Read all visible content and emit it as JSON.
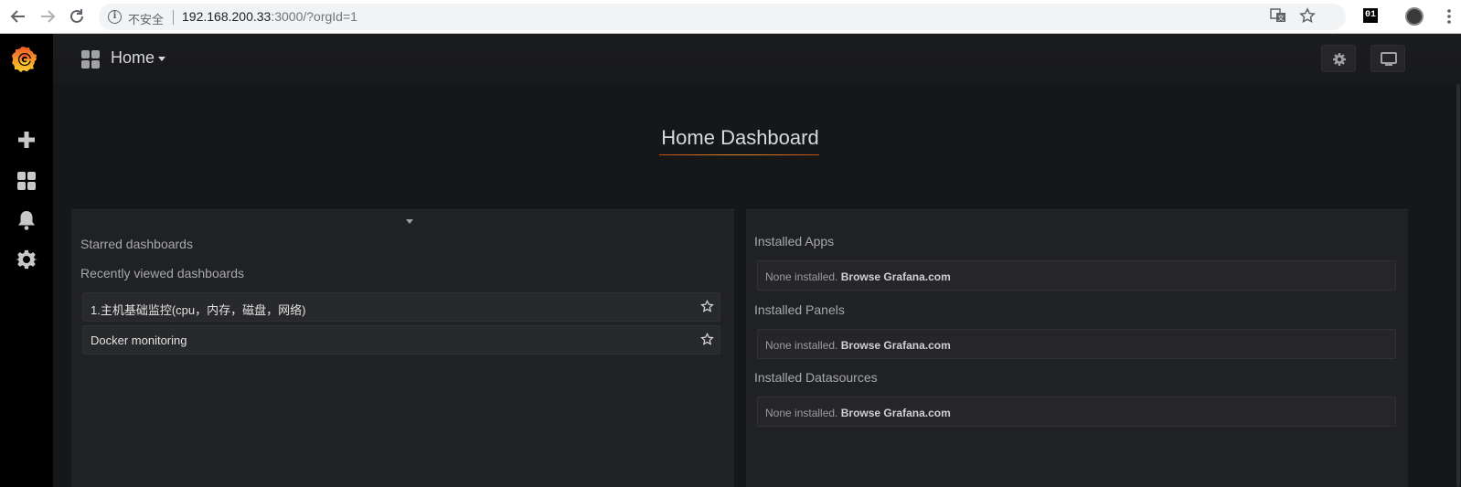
{
  "browser": {
    "insecure_label": "不安全",
    "url_host": "192.168.200.33",
    "url_rest": ":3000/?orgId=1",
    "ext_badge": "01",
    "icons": [
      "back-arrow-icon",
      "forward-arrow-icon",
      "reload-icon",
      "info-icon",
      "translate-icon",
      "bookmark-star-icon",
      "profile-avatar-icon",
      "menu-dots-icon"
    ]
  },
  "sidemenu": {
    "logo": "grafana-logo",
    "items": [
      {
        "icon": "plus-icon",
        "name": "create"
      },
      {
        "icon": "dashboards-grid-icon",
        "name": "dashboards"
      },
      {
        "icon": "bell-icon",
        "name": "alerting"
      },
      {
        "icon": "gear-icon",
        "name": "configuration"
      }
    ]
  },
  "navbar": {
    "title": "Home",
    "buttons": [
      "gear-icon",
      "monitor-icon"
    ]
  },
  "home": {
    "heading": "Home Dashboard"
  },
  "left_panel": {
    "starred_title": "Starred dashboards",
    "recent_title": "Recently viewed dashboards",
    "recent": [
      {
        "label": "1.主机基础监控(cpu，内存，磁盘，网络)"
      },
      {
        "label": "Docker monitoring"
      }
    ]
  },
  "right_panel": {
    "sections": [
      {
        "title": "Installed Apps",
        "none_text": "None installed.",
        "link_text": "Browse Grafana.com"
      },
      {
        "title": "Installed Panels",
        "none_text": "None installed.",
        "link_text": "Browse Grafana.com"
      },
      {
        "title": "Installed Datasources",
        "none_text": "None installed.",
        "link_text": "Browse Grafana.com"
      }
    ]
  },
  "colors": {
    "background": "#161719",
    "sidemenu": "#000000",
    "panel": "#202123",
    "accent": "#e08a2f",
    "text": "#d8d9da"
  }
}
